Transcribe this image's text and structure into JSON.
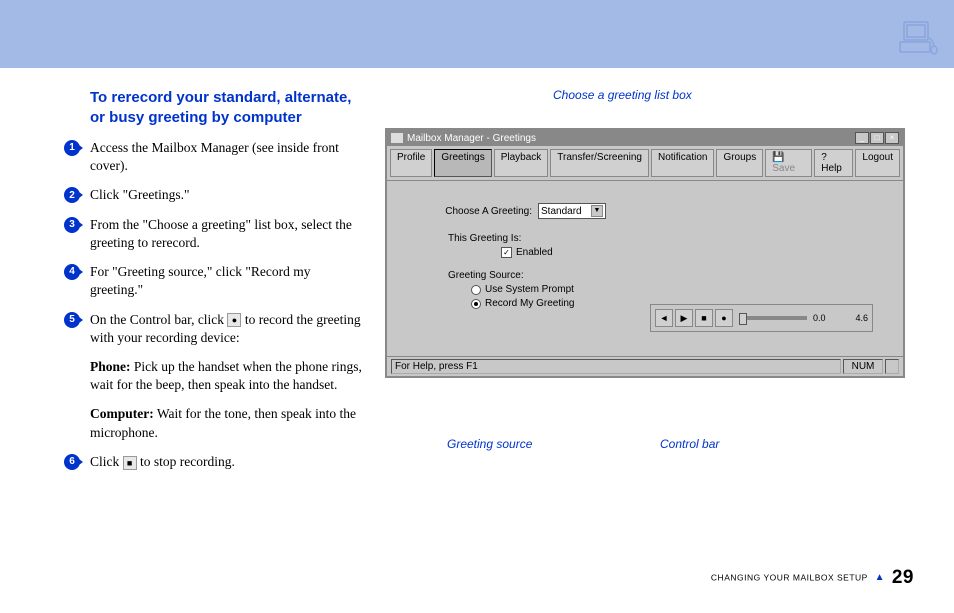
{
  "heading": "To rerecord your standard, alternate, or busy greeting by computer",
  "steps": {
    "s1": "Access the Mailbox Manager (see inside front cover).",
    "s2": "Click \"Greetings.\"",
    "s3": "From the \"Choose a greeting\" list box, select the greeting to rerecord.",
    "s4": "For \"Greeting source,\" click \"Record my greeting.\"",
    "s5_a": "On the Control bar, click ",
    "s5_b": " to record the greeting with your recording device:",
    "s5_phone_label": "Phone:",
    "s5_phone": " Pick up the handset when the phone rings, wait for the beep, then speak into the handset.",
    "s5_comp_label": "Computer:",
    "s5_comp": " Wait for the tone, then speak into the microphone.",
    "s6_a": "Click ",
    "s6_b": " to stop recording."
  },
  "callouts": {
    "top": "Choose a greeting list box",
    "bl": "Greeting source",
    "br": "Control bar"
  },
  "window": {
    "title": "Mailbox Manager - Greetings",
    "toolbar": {
      "profile": "Profile",
      "greetings": "Greetings",
      "playback": "Playback",
      "transfer": "Transfer/Screening",
      "notification": "Notification",
      "groups": "Groups",
      "save": "Save",
      "help": "? Help",
      "logout": "Logout"
    },
    "form": {
      "choose_label": "Choose A Greeting:",
      "choose_value": "Standard",
      "greeting_is": "This Greeting Is:",
      "enabled": "Enabled",
      "source_label": "Greeting Source:",
      "opt1": "Use System Prompt",
      "opt2": "Record My Greeting"
    },
    "controlbar": {
      "t_start": "0.0",
      "t_end": "4.6"
    },
    "statusbar": {
      "help": "For Help, press F1",
      "num": "NUM"
    }
  },
  "footer": {
    "section": "CHANGING YOUR MAILBOX SETUP",
    "page": "29"
  }
}
